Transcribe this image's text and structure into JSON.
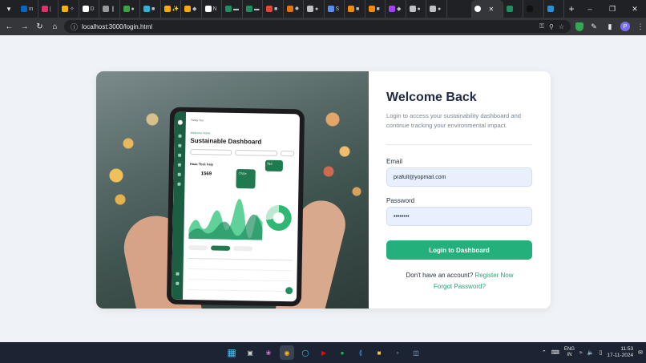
{
  "browser": {
    "tabs": [
      {
        "fav": "#0a66c2",
        "label": "in"
      },
      {
        "fav": "#e1306c",
        "label": "("
      },
      {
        "fav": "#f4b400",
        "label": "✧"
      },
      {
        "fav": "#ffffff",
        "label": "D"
      },
      {
        "fav": "#999999",
        "label": "❙"
      },
      {
        "fav": "#43a047",
        "label": "●"
      },
      {
        "fav": "#2bb5d8",
        "label": "■"
      },
      {
        "fav": "#f9ab00",
        "label": "✨"
      },
      {
        "fav": "#f9ab00",
        "label": "◆"
      },
      {
        "fav": "#ffffff",
        "label": "N"
      },
      {
        "fav": "#1f8f5f",
        "label": "▬"
      },
      {
        "fav": "#1f8f5f",
        "label": "▬"
      },
      {
        "fav": "#ea4335",
        "label": "■"
      },
      {
        "fav": "#e8710a",
        "label": "✹"
      },
      {
        "fav": "#bdc1c6",
        "label": "●"
      },
      {
        "fav": "#5b8def",
        "label": "S"
      },
      {
        "fav": "#f28b00",
        "label": "■"
      },
      {
        "fav": "#f28b00",
        "label": "■"
      },
      {
        "fav": "#a142f4",
        "label": "◆"
      },
      {
        "fav": "#bdc1c6",
        "label": "●"
      },
      {
        "fav": "#bdc1c6",
        "label": "●"
      }
    ],
    "active_tab_icon": "G",
    "url": "localhost:3000/login.html",
    "profile_initial": "P"
  },
  "login": {
    "title": "Welcome Back",
    "subtitle": "Login to access your sustainability dashboard and continue tracking your environmental impact.",
    "email_label": "Email",
    "email_value": "prafull@yopmail.com",
    "password_label": "Password",
    "password_value": "••••••••",
    "submit_label": "Login to Dashboard",
    "no_account_text": "Don't have an account?",
    "register_link": "Register Now",
    "forgot_link": "Forgot Password?"
  },
  "hero_screen": {
    "top_text": "Today Yes",
    "subtitle": "Welcome Home",
    "title": "Sustainable Dashboard",
    "section": "Haaa Tbs1 haiy",
    "value": "1569",
    "badge1": "77/0+",
    "badge2": "763"
  },
  "taskbar": {
    "lang_top": "ENG",
    "lang_bottom": "IN",
    "time": "11:53",
    "date": "17-11-2024"
  }
}
